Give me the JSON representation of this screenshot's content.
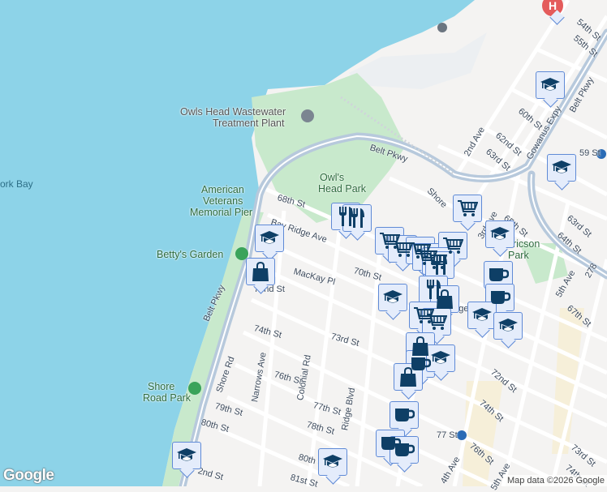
{
  "map": {
    "colors": {
      "water": "#8dd3e8",
      "land": "#f4f3f2",
      "park": "#c8e9cc",
      "highway": "#b7c9dc",
      "marker_fill": "#e4ecfb",
      "marker_border": "#5f8ad6",
      "icon": "#0e3f66"
    },
    "labels": [
      "Owls Head Wastewater",
      "Treatment Plant",
      "American",
      "Veterans",
      "Memorial Pier",
      "ork Bay",
      "Betty's Garden",
      "Owl's",
      "Head Park",
      "Belt Pkwy",
      "68th St",
      "Bay Ridge Ave",
      "MacKay Pl",
      "70th St",
      "72nd St",
      "74th St",
      "73rd St",
      "76th St",
      "77th St",
      "78th St",
      "79th St",
      "80th St",
      "80th St",
      "81st St",
      "2nd St",
      "Shore Rd",
      "Belt Pkwy",
      "Colonial Rd",
      "Narrows Ave",
      "Ridge Blvd",
      "Shore",
      "Road Park",
      "Shore",
      "3rd Ave",
      "65th St",
      "2nd Ave",
      "62nd St",
      "63rd St",
      "60th St",
      "55th St",
      "54th St",
      "Gowanus Expy",
      "59 St",
      "63rd St",
      "64th St",
      "67th St",
      "5th Ave",
      "72nd St",
      "74th St",
      "76th St",
      "77 St",
      "4th Ave",
      "5th Ave",
      "73rd St",
      "74th St",
      "Belt Pkwy",
      "Lief Ericson",
      "Park",
      "278",
      "ridge"
    ],
    "markers": [
      "school",
      "school",
      "cart",
      "school",
      "restaurant",
      "restaurant",
      "school",
      "bag",
      "cart",
      "cart",
      "cart",
      "cart",
      "cart",
      "cart",
      "restaurant",
      "coffee",
      "coffee",
      "school",
      "restaurant",
      "bag",
      "cart",
      "cart",
      "school",
      "school",
      "bag",
      "coffee",
      "school",
      "bag",
      "coffee",
      "coffee",
      "coffee",
      "school",
      "school"
    ],
    "hospital_icon": "hospital-icon",
    "logo": "Google",
    "attribution": "Map data ©2026 Google"
  }
}
